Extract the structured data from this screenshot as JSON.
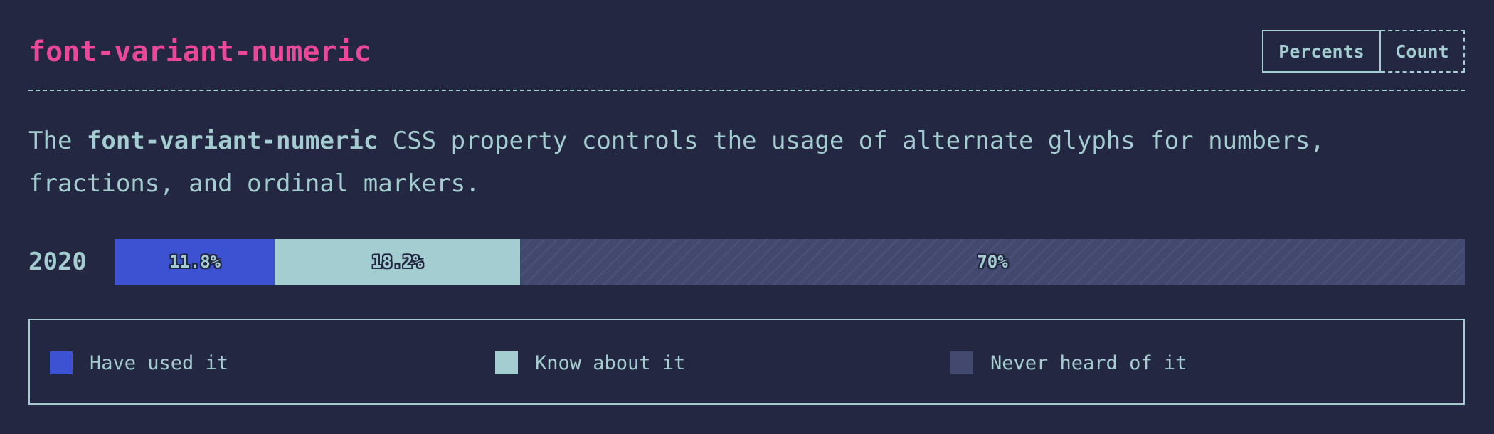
{
  "header": {
    "title": "font-variant-numeric"
  },
  "toggle": {
    "options": [
      "Percents",
      "Count"
    ],
    "selected": "Percents"
  },
  "description": {
    "prefix": "The ",
    "property": "font-variant-numeric",
    "suffix": " CSS property controls the usage of alternate glyphs for numbers, fractions, and ordinal markers."
  },
  "colors": {
    "have_used": "#3d51d3",
    "know_about": "#a3cdd0",
    "never_heard": "#43486e",
    "title": "#ec4899"
  },
  "chart_data": {
    "type": "bar",
    "orientation": "horizontal",
    "stacked": true,
    "unit": "percent",
    "categories": [
      "2020"
    ],
    "series": [
      {
        "name": "Have used it",
        "values": [
          11.8
        ],
        "label": "11.8%"
      },
      {
        "name": "Know about it",
        "values": [
          18.2
        ],
        "label": "18.2%"
      },
      {
        "name": "Never heard of it",
        "values": [
          70
        ],
        "label": "70%"
      }
    ],
    "xlim": [
      0,
      100
    ],
    "legend_position": "bottom"
  }
}
